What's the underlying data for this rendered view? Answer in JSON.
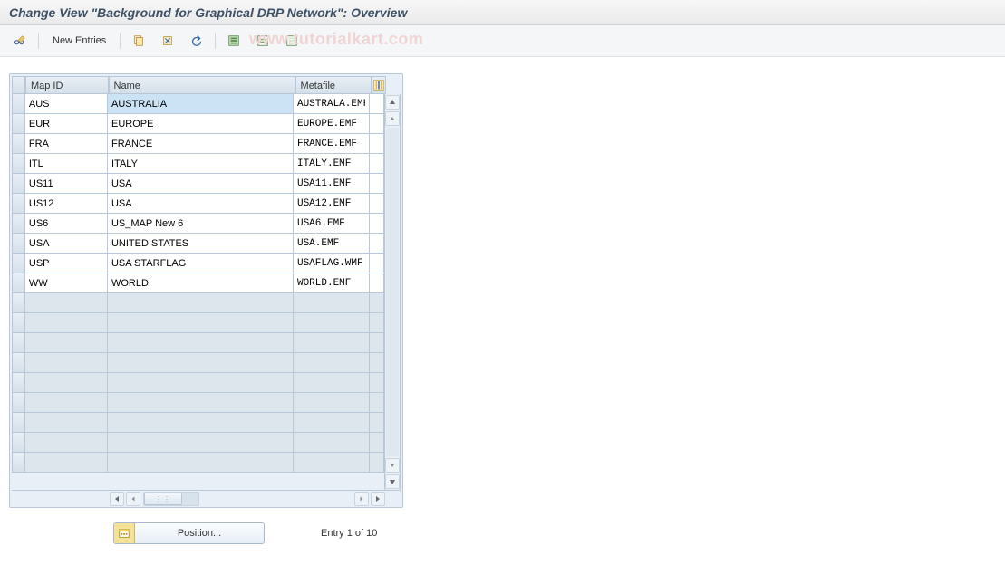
{
  "title": "Change View \"Background for Graphical DRP Network\": Overview",
  "toolbar": {
    "new_entries_label": "New Entries"
  },
  "watermark": "www.tutorialkart.com",
  "table": {
    "headers": {
      "map_id": "Map ID",
      "name": "Name",
      "metafile": "Metafile"
    },
    "rows": [
      {
        "map_id": "AUS",
        "name": "AUSTRALIA",
        "metafile": "AUSTRALA.EMF",
        "selected": true
      },
      {
        "map_id": "EUR",
        "name": "EUROPE",
        "metafile": "EUROPE.EMF"
      },
      {
        "map_id": "FRA",
        "name": "FRANCE",
        "metafile": "FRANCE.EMF"
      },
      {
        "map_id": "ITL",
        "name": "ITALY",
        "metafile": "ITALY.EMF"
      },
      {
        "map_id": "US11",
        "name": "USA",
        "metafile": "USA11.EMF"
      },
      {
        "map_id": "US12",
        "name": "USA",
        "metafile": "USA12.EMF"
      },
      {
        "map_id": "US6",
        "name": "US_MAP New 6",
        "metafile": "USA6.EMF"
      },
      {
        "map_id": "USA",
        "name": "UNITED STATES",
        "metafile": "USA.EMF"
      },
      {
        "map_id": "USP",
        "name": "USA STARFLAG",
        "metafile": "USAFLAG.WMF"
      },
      {
        "map_id": "WW",
        "name": "WORLD",
        "metafile": "WORLD.EMF"
      }
    ],
    "empty_rows": 9
  },
  "footer": {
    "position_label": "Position...",
    "entry_info": "Entry 1 of 10"
  }
}
